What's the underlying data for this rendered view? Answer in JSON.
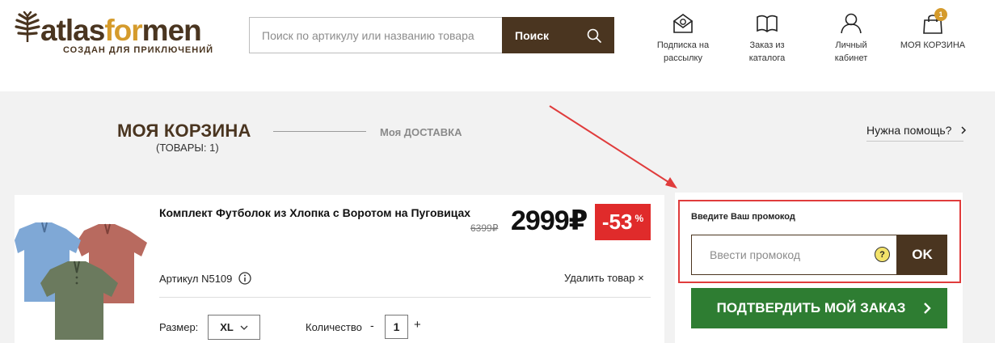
{
  "header": {
    "logo": {
      "word_part1": "atlas",
      "word_accent": "for",
      "word_part2": "men",
      "tagline": "СОЗДАН ДЛЯ ПРИКЛЮЧЕНИЙ"
    },
    "search": {
      "placeholder": "Поиск по артикулу или названию товара",
      "button_label": "Поиск"
    },
    "nav": [
      {
        "icon": "envelope-icon",
        "line1": "Подписка на",
        "line2": "рассылку"
      },
      {
        "icon": "book-icon",
        "line1": "Заказ из",
        "line2": "каталога"
      },
      {
        "icon": "user-icon",
        "line1": "Личный",
        "line2": "кабинет"
      },
      {
        "icon": "bag-icon",
        "line1": "МОЯ КОРЗИНА",
        "badge": "1"
      }
    ]
  },
  "steps": {
    "title": "МОЯ КОРЗИНА",
    "count": "(ТОВАРЫ: 1)",
    "next_step": "Моя ДОСТАВКА",
    "help": "Нужна помощь?",
    "help_icon": "chevron-right-icon"
  },
  "cart_item": {
    "title": "Комплект Футболок из Хлопка с Воротом на Пуговицах",
    "old_price": "6399₽",
    "price": "2999₽",
    "discount_value": "-53",
    "discount_percent": "%",
    "article": "Артикул N5109",
    "remove": "Удалить товар ×",
    "size_label": "Размер:",
    "size_value": "XL",
    "qty_label": "Количество",
    "qty_minus": "-",
    "qty_value": "1",
    "qty_plus": "+"
  },
  "promo": {
    "label": "Введите Ваш промокод",
    "placeholder": "Ввести промокод",
    "help_glyph": "?",
    "ok": "OK",
    "confirm": "ПОДТВЕРДИТЬ МОЙ ЗАКАЗ",
    "confirm_icon": "chevron-right-icon"
  },
  "colors": {
    "brand_brown": "#4a3520",
    "brand_gold": "#d59b2c",
    "confirm_green": "#2e7d32",
    "discount_red": "#e02b2b",
    "annotation_red": "#e03c3c"
  }
}
